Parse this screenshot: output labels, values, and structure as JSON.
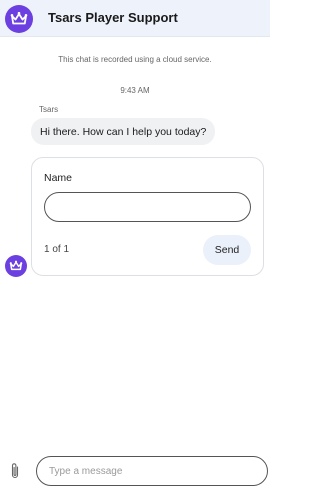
{
  "header": {
    "title": "Tsars Player Support",
    "icon": "crown-icon",
    "brand_color": "#6b3fe0",
    "background": "#eef3fb"
  },
  "chat": {
    "notice": "This chat is recorded using a cloud service.",
    "timestamp": "9:43 AM",
    "sender": "Tsars",
    "messages": [
      {
        "text": "Hi there. How can I help you today?"
      }
    ]
  },
  "form": {
    "field_label": "Name",
    "field_value": "",
    "pager": "1 of 1",
    "send_label": "Send"
  },
  "composer": {
    "placeholder": "Type a message",
    "attach_icon": "paperclip-icon"
  }
}
